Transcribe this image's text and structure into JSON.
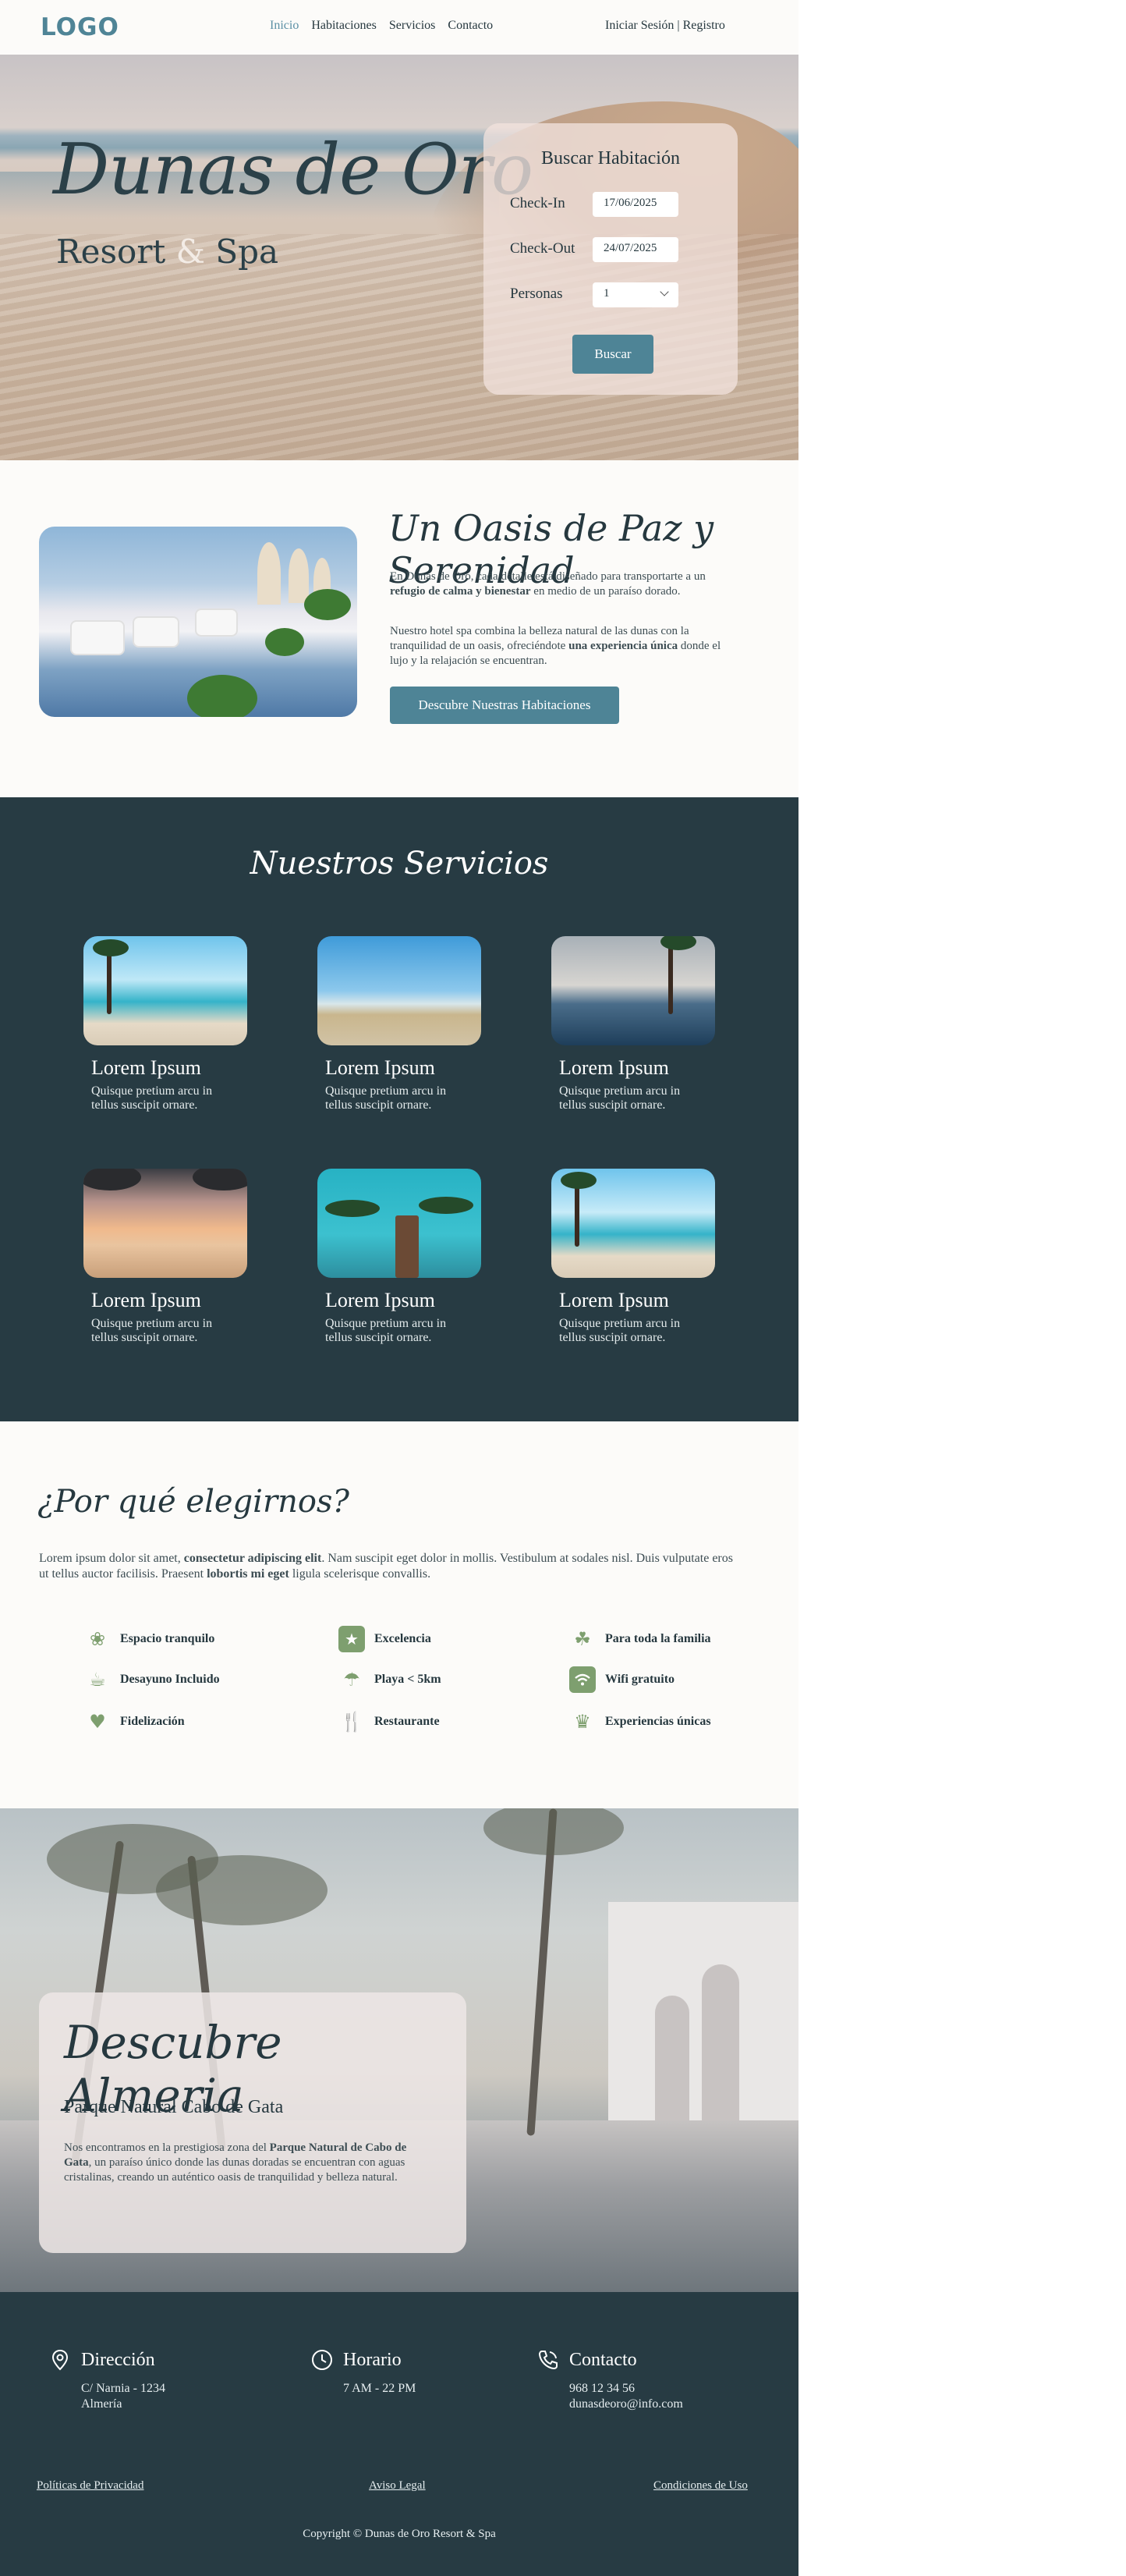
{
  "header": {
    "logo": "LOGO",
    "nav": [
      "Inicio",
      "Habitaciones",
      "Servicios",
      "Contacto"
    ],
    "login": "Iniciar Sesión | Registro"
  },
  "hero": {
    "title": "Dunas de Oro",
    "subtitle_part1": "Resort",
    "subtitle_amp": "&",
    "subtitle_part2": "Spa",
    "search": {
      "title": "Buscar Habitación",
      "checkin_label": "Check-In",
      "checkin_value": "17/06/2025",
      "checkout_label": "Check-Out",
      "checkout_value": "24/07/2025",
      "persons_label": "Personas",
      "persons_value": "1",
      "button": "Buscar"
    }
  },
  "oasis": {
    "title": "Un Oasis de Paz y Serenidad",
    "p1_a": "En Dunas de Oro, cada detalle está diseñado para transportarte a un ",
    "p1_b": "refugio de calma y bienestar",
    "p1_c": " en medio de un paraíso dorado.",
    "p2_a": "Nuestro hotel spa combina la belleza natural de las dunas con la tranquilidad de un oasis, ofreciéndote ",
    "p2_b": "una experiencia única",
    "p2_c": " donde el lujo y la relajación se encuentran.",
    "button": "Descubre Nuestras Habitaciones"
  },
  "services": {
    "title": "Nuestros Servicios",
    "items": [
      {
        "title": "Lorem Ipsum",
        "text": "Quisque pretium arcu in tellus suscipit ornare."
      },
      {
        "title": "Lorem Ipsum",
        "text": "Quisque pretium arcu in tellus suscipit ornare."
      },
      {
        "title": "Lorem Ipsum",
        "text": "Quisque pretium arcu in tellus suscipit ornare."
      },
      {
        "title": "Lorem Ipsum",
        "text": "Quisque pretium arcu in tellus suscipit ornare."
      },
      {
        "title": "Lorem Ipsum",
        "text": "Quisque pretium arcu in tellus suscipit ornare."
      },
      {
        "title": "Lorem Ipsum",
        "text": "Quisque pretium arcu in tellus suscipit ornare."
      }
    ]
  },
  "why": {
    "title": "¿Por qué elegirnos?",
    "p_a": "Lorem ipsum dolor sit amet, ",
    "p_b": "consectetur adipiscing elit",
    "p_c": ". Nam suscipit eget dolor in mollis. Vestibulum at sodales nisl. Duis vulputate eros ut tellus auctor facilisis. Praesent ",
    "p_d": "lobortis mi eget",
    "p_e": " ligula scelerisque convallis.",
    "features": [
      {
        "label": "Espacio tranquilo",
        "icon": "lotus-icon"
      },
      {
        "label": "Excelencia",
        "icon": "star-badge-icon"
      },
      {
        "label": "Para toda la familia",
        "icon": "family-icon"
      },
      {
        "label": "Desayuno Incluido",
        "icon": "coffee-icon"
      },
      {
        "label": "Playa < 5km",
        "icon": "beach-umbrella-icon"
      },
      {
        "label": "Wifi gratuito",
        "icon": "wifi-icon"
      },
      {
        "label": "Fidelización",
        "icon": "hand-heart-icon"
      },
      {
        "label": "Restaurante",
        "icon": "cutlery-icon"
      },
      {
        "label": "Experiencias únicas",
        "icon": "trophy-icon"
      }
    ]
  },
  "discover": {
    "title": "Descubre Almeria",
    "subtitle": "Parque Natural Cabo de Gata",
    "p_a": "Nos encontramos en la prestigiosa zona del ",
    "p_b": "Parque Natural de Cabo de Gata",
    "p_c": ", un paraíso único donde las dunas doradas se encuentran con aguas cristalinas, creando un auténtico oasis de tranquilidad y belleza natural."
  },
  "footer": {
    "address_title": "Dirección",
    "address_lines": [
      "C/ Narnia - 1234",
      "Almería"
    ],
    "hours_title": "Horario",
    "hours": "7 AM - 22 PM",
    "contact_title": "Contacto",
    "phone": "968 12 34 56",
    "email": "dunasdeoro@info.com",
    "links": [
      "Políticas de Privacidad",
      "Aviso Legal",
      "Condiciones de Uso"
    ],
    "copyright": "Copyright © Dunas de Oro Resort & Spa"
  },
  "colors": {
    "accent": "#4e8496",
    "dark": "#273b43",
    "icon_green": "#7e9f6f",
    "bg": "#fcfbf9"
  }
}
